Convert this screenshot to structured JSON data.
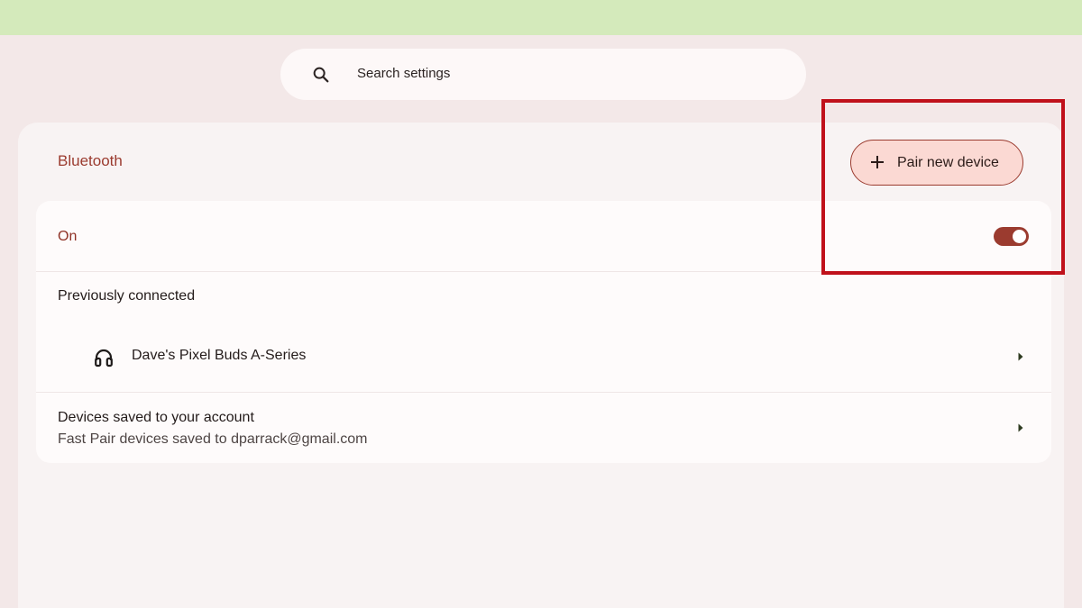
{
  "search": {
    "placeholder": "Search settings",
    "icon": "search-icon"
  },
  "page": {
    "title": "Bluetooth"
  },
  "actions": {
    "pair_label": "Pair new device",
    "pair_icon": "plus-icon"
  },
  "bluetooth": {
    "state_label": "On",
    "enabled": true
  },
  "previously_connected": {
    "heading": "Previously connected",
    "devices": [
      {
        "name": "Dave's Pixel Buds A-Series",
        "icon": "headphones-icon"
      }
    ]
  },
  "saved_devices": {
    "title": "Devices saved to your account",
    "subtitle": "Fast Pair devices saved to dparrack@gmail.com"
  },
  "colors": {
    "accent": "#9b3b2f",
    "top_bar": "#d4eabb",
    "background": "#f3e8e8",
    "highlight": "#c0111b"
  }
}
